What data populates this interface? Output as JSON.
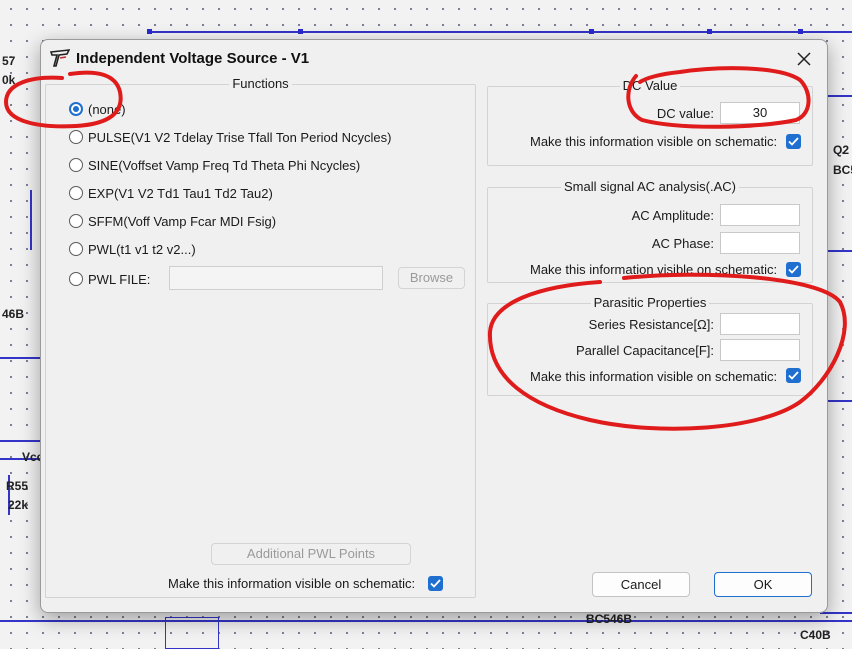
{
  "background_labels": {
    "top_left_1": "57",
    "top_left_2": "0k",
    "left_mid": "46B",
    "vcc": "Vcc",
    "r55": "R55",
    "r55_value": "22k",
    "q_right": "Q2",
    "bc_right": "BC5",
    "bottom_transistor": "BC546B",
    "bottom_right": "C40B"
  },
  "dialog": {
    "title": "Independent Voltage Source - V1",
    "functions": {
      "title": "Functions",
      "options": [
        {
          "label": "(none)",
          "checked": true
        },
        {
          "label": "PULSE(V1 V2 Tdelay Trise Tfall Ton Period Ncycles)",
          "checked": false
        },
        {
          "label": "SINE(Voffset Vamp Freq Td Theta Phi Ncycles)",
          "checked": false
        },
        {
          "label": "EXP(V1 V2 Td1 Tau1 Td2 Tau2)",
          "checked": false
        },
        {
          "label": "SFFM(Voff Vamp Fcar MDI Fsig)",
          "checked": false
        },
        {
          "label": "PWL(t1 v1 t2 v2...)",
          "checked": false
        },
        {
          "label": "PWL FILE:",
          "checked": false
        }
      ],
      "pwl_file_value": "",
      "browse_label": "Browse",
      "additional_pwl_label": "Additional PWL Points",
      "visible_label": "Make this information visible on schematic:",
      "visible_checked": true
    },
    "dc_value": {
      "title": "DC Value",
      "field_label": "DC value:",
      "field_value": "30",
      "visible_label": "Make this information visible on schematic:",
      "visible_checked": true
    },
    "ac_analysis": {
      "title": "Small signal AC analysis(.AC)",
      "amplitude_label": "AC Amplitude:",
      "amplitude_value": "",
      "phase_label": "AC Phase:",
      "phase_value": "",
      "visible_label": "Make this information visible on schematic:",
      "visible_checked": true
    },
    "parasitic": {
      "title": "Parasitic Properties",
      "series_label": "Series Resistance[Ω]:",
      "series_value": "",
      "parallel_label": "Parallel Capacitance[F]:",
      "parallel_value": "",
      "visible_label": "Make this information visible on schematic:",
      "visible_checked": true
    },
    "cancel_label": "Cancel",
    "ok_label": "OK"
  },
  "colors": {
    "accent": "#1f6fd1",
    "annotation": "#e01b1b",
    "wire": "#3434c8"
  }
}
